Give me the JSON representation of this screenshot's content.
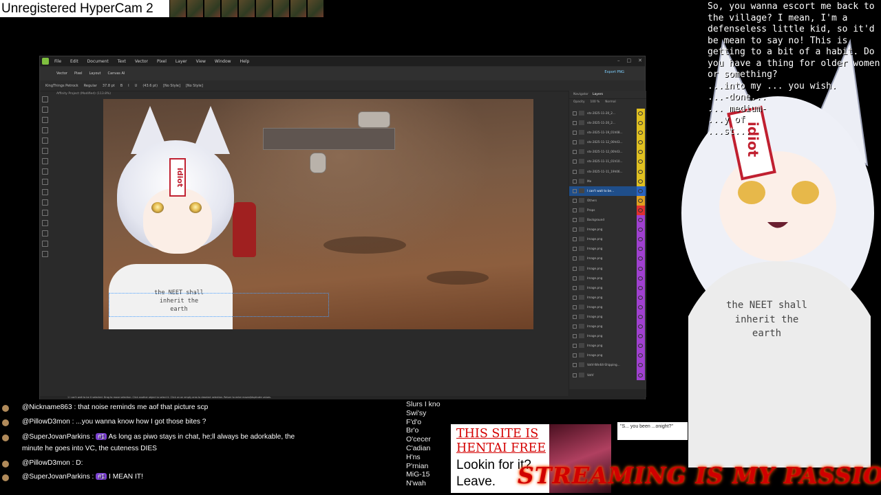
{
  "overlay": {
    "watermark": "Unregistered HyperCam 2",
    "dialog": "So, you wanna escort me back to the village? I mean, I'm a defenseless little kid, so it'd be mean to say no! This is getting to a bit of a habit. Do you have a thing for older women or something?\n...into my ... you wish.\n...-done...\n... medium-\n...y of\n...st...",
    "shirt_text": "the NEET shall\ninherit the\nearth",
    "tag_text": "idiot",
    "banner": "STREAMING IS MY PASSION"
  },
  "app": {
    "menu": [
      "File",
      "Edit",
      "Document",
      "Text",
      "Vector",
      "Pixel",
      "Layer",
      "View",
      "Window",
      "Help"
    ],
    "personas": [
      "Vector",
      "Pixel",
      "Layout",
      "Canvas AI"
    ],
    "export_label": "Export PNG",
    "context": {
      "font": "KingThings Petrock",
      "weight": "Regular",
      "size": "37.8 pt",
      "leading": "(43.6 pt)",
      "style1": "[No Style]",
      "style2": "[No Style]"
    },
    "doc_title": "Affinity Project (Modified) (113.8%)",
    "status": "1 I can't wait to be U selected. Drag to move selection. Click another object to select it. Click on an empty area to deselect selection. Return to enter moved/duplicate values.",
    "panel": {
      "tabs": [
        "Navigator",
        "Layers"
      ],
      "opacity_label": "Opacity",
      "opacity_value": "100 %",
      "blend": "Normal"
    },
    "layers": [
      {
        "name": "vts-2025-11-20_2...",
        "color": "#e0c020"
      },
      {
        "name": "vts-2025-11-20_2...",
        "color": "#e0c020"
      },
      {
        "name": "vts-2025-11-19_01h08...",
        "color": "#e0c020"
      },
      {
        "name": "vts-2025-11-12_00h43...",
        "color": "#e0c020"
      },
      {
        "name": "vts-2025-11-12_00h43...",
        "color": "#e0c020"
      },
      {
        "name": "vts-2025-11-11_01h10...",
        "color": "#e0c020"
      },
      {
        "name": "vts-2025-11-11_19h06...",
        "color": "#e0c020"
      },
      {
        "name": "Me",
        "color": "#e0c020"
      },
      {
        "name": "I can't wait to be...",
        "color": "#2a63c2",
        "selected": true
      },
      {
        "name": "Others",
        "color": "#e0a020"
      },
      {
        "name": "Props",
        "color": "#e03030"
      },
      {
        "name": "Background",
        "color": "#a040d0"
      },
      {
        "name": "Image.png",
        "color": "#a040d0"
      },
      {
        "name": "Image.png",
        "color": "#a040d0"
      },
      {
        "name": "Image.png",
        "color": "#a040d0"
      },
      {
        "name": "Image.png",
        "color": "#a040d0"
      },
      {
        "name": "Image.png",
        "color": "#a040d0"
      },
      {
        "name": "Image.png",
        "color": "#a040d0"
      },
      {
        "name": "Image.png",
        "color": "#a040d0"
      },
      {
        "name": "Image.png",
        "color": "#a040d0"
      },
      {
        "name": "Image.png",
        "color": "#a040d0"
      },
      {
        "name": "Image.png",
        "color": "#a040d0"
      },
      {
        "name": "Image.png",
        "color": "#a040d0"
      },
      {
        "name": "Image.png",
        "color": "#a040d0"
      },
      {
        "name": "Image.png",
        "color": "#a040d0"
      },
      {
        "name": "Image.png",
        "color": "#a040d0"
      },
      {
        "name": "VotV-Win64-Shipping...",
        "color": "#a040d0"
      },
      {
        "name": "VotV",
        "color": "#a040d0"
      }
    ]
  },
  "chat": [
    {
      "user": "@Nickname863",
      "text": "that noise reminds me aof that picture scp"
    },
    {
      "user": "@PillowD3mon",
      "text": "...you wanna know how I got those bites ?"
    },
    {
      "user": "@SuperJovanParkins",
      "badge": "#1",
      "text": "As long as piwo stays in chat, he;ll always be adorkable, the"
    },
    {
      "user": "",
      "text": "minute he goes into VC, the cuteness DIES"
    },
    {
      "user": "@PillowD3mon",
      "text": "D:"
    },
    {
      "user": "@SuperJovanParkins",
      "badge": "#1",
      "text": "I MEAN IT!"
    }
  ],
  "partial_list": "Slurs I kno\nSwi'sy\nF'd'o\nBr'o\nO'cecer\nC'adian\nH'ns\nP'rnian\nMiG-15\nN'wah",
  "ad": {
    "headline": "THIS SITE IS\nHENTAI FREE",
    "body": "Lookin for it?\nLeave."
  },
  "promo": "\"S... you been\n...onight?\""
}
